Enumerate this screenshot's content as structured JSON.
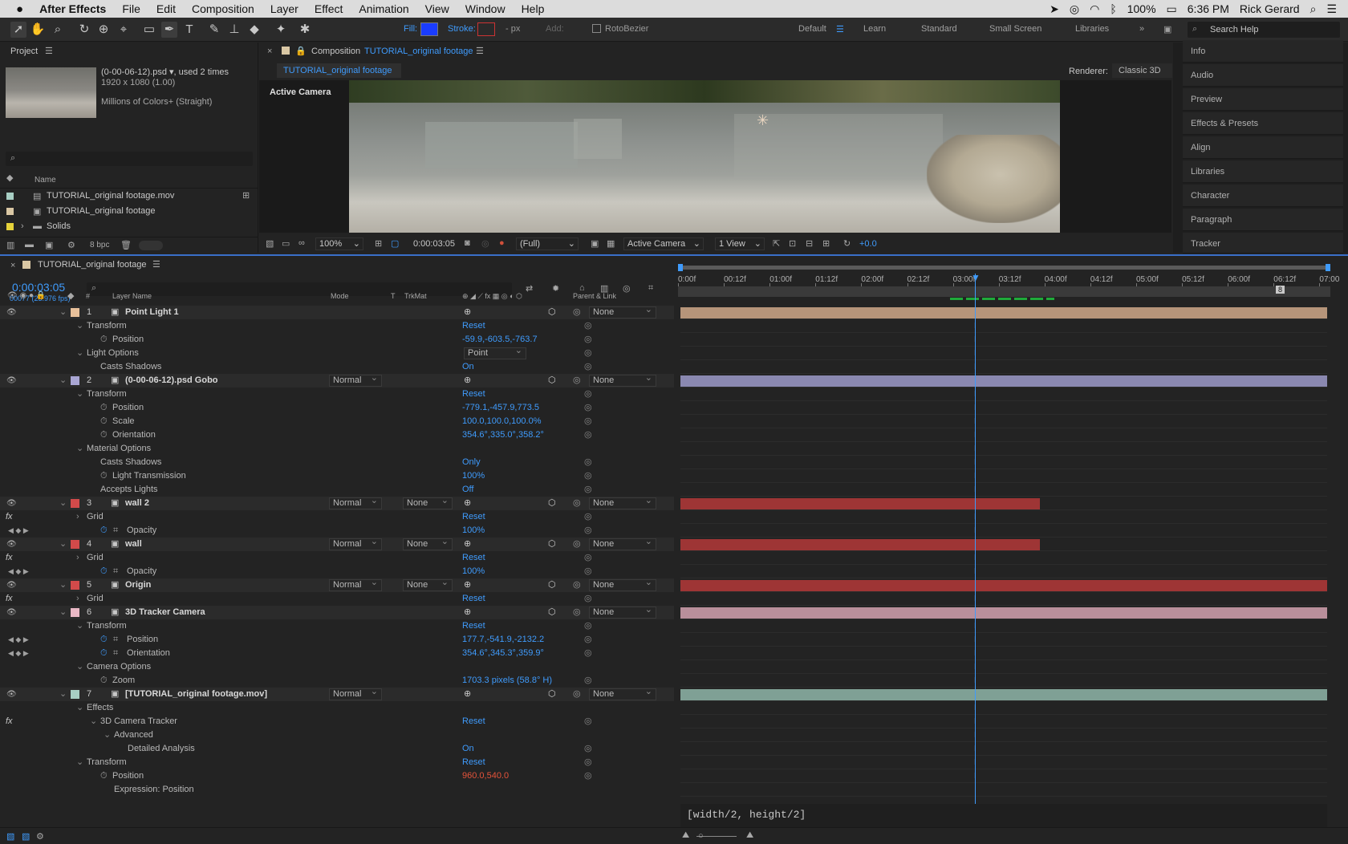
{
  "menubar": {
    "apple": "",
    "app": "After Effects",
    "items": [
      "File",
      "Edit",
      "Composition",
      "Layer",
      "Effect",
      "Animation",
      "View",
      "Window",
      "Help"
    ],
    "battery": "100%",
    "time": "6:36 PM",
    "user": "Rick Gerard"
  },
  "toolbar": {
    "fill_label": "Fill:",
    "stroke_label": "Stroke:",
    "px_label": "- px",
    "add_label": "Add:",
    "rotobezier": "RotoBezier",
    "workspaces": [
      "Default",
      "Learn",
      "Standard",
      "Small Screen",
      "Libraries"
    ],
    "search_placeholder": "Search Help"
  },
  "project": {
    "title": "Project",
    "file_name": "(0-00-06-12).psd",
    "used": ", used 2 times",
    "dims": "1920 x 1080 (1.00)",
    "colors": "Millions of Colors+ (Straight)",
    "search": "",
    "col_name": "Name",
    "items": [
      "TUTORIAL_original footage.mov",
      "TUTORIAL_original footage",
      "Solids"
    ],
    "bpc": "8 bpc"
  },
  "composition": {
    "title_prefix": "Composition",
    "title_name": "TUTORIAL_original footage",
    "tab": "TUTORIAL_original footage",
    "renderer_label": "Renderer:",
    "renderer": "Classic 3D",
    "camera_label": "Active Camera",
    "zoom": "100%",
    "timecode": "0:00:03:05",
    "resolution": "(Full)",
    "view_camera": "Active Camera",
    "views": "1 View",
    "exposure": "+0.0"
  },
  "side": {
    "items": [
      "Info",
      "Audio",
      "Preview",
      "Effects & Presets",
      "Align",
      "Libraries",
      "Character",
      "Paragraph",
      "Tracker"
    ]
  },
  "timeline": {
    "tab": "TUTORIAL_original footage",
    "timecode": "0:00:03:05",
    "frames": "00077 (23.976 fps)",
    "col_num": "#",
    "col_layer": "Layer Name",
    "col_mode": "Mode",
    "col_t": "T",
    "col_trk": "TrkMat",
    "col_parent": "Parent & Link",
    "ruler": [
      "0:00f",
      "00:12f",
      "01:00f",
      "01:12f",
      "02:00f",
      "02:12f",
      "03:00f",
      "03:12f",
      "04:00f",
      "04:12f",
      "05:00f",
      "05:12f",
      "06:00f",
      "06:12f",
      "07:00"
    ],
    "expression": "[width/2, height/2]",
    "marker": "8"
  },
  "rows": [
    {
      "kind": "layer",
      "num": "1",
      "name": "Point Light 1",
      "color": "#e8c09a",
      "icon": "light-icon",
      "mode": "",
      "trk": "",
      "parent": "None"
    },
    {
      "kind": "group",
      "label": "Transform",
      "reset": "Reset"
    },
    {
      "kind": "prop",
      "label": "Position",
      "value": "-59.9,-603.5,-763.7"
    },
    {
      "kind": "group",
      "label": "Light Options",
      "value": "Point"
    },
    {
      "kind": "sub",
      "label": "Casts Shadows",
      "value": "On"
    },
    {
      "kind": "layer",
      "num": "2",
      "name": "(0-00-06-12).psd Gobo",
      "color": "#a9a6d3",
      "icon": "footage-icon",
      "mode": "Normal",
      "trk": "",
      "parent": "None"
    },
    {
      "kind": "group",
      "label": "Transform",
      "reset": "Reset"
    },
    {
      "kind": "prop",
      "label": "Position",
      "value": "-779.1,-457.9,773.5"
    },
    {
      "kind": "prop",
      "label": "Scale",
      "value": "100.0,100.0,100.0%"
    },
    {
      "kind": "prop",
      "label": "Orientation",
      "value": "354.6°,335.0°,358.2°"
    },
    {
      "kind": "group",
      "label": "Material Options"
    },
    {
      "kind": "sub",
      "label": "Casts Shadows",
      "value": "Only"
    },
    {
      "kind": "prop",
      "label": "Light Transmission",
      "value": "100%"
    },
    {
      "kind": "sub",
      "label": "Accepts Lights",
      "value": "Off"
    },
    {
      "kind": "layer",
      "num": "3",
      "name": "wall 2",
      "color": "#d24a4a",
      "icon": "solid-icon",
      "mode": "Normal",
      "trk": "None",
      "parent": "None"
    },
    {
      "kind": "fxgroup",
      "label": "Grid",
      "reset": "Reset"
    },
    {
      "kind": "kprop",
      "label": "Opacity",
      "value": "100%"
    },
    {
      "kind": "layer",
      "num": "4",
      "name": "wall",
      "color": "#d24a4a",
      "icon": "solid-icon",
      "mode": "Normal",
      "trk": "None",
      "parent": "None"
    },
    {
      "kind": "fxgroup",
      "label": "Grid",
      "reset": "Reset"
    },
    {
      "kind": "kprop",
      "label": "Opacity",
      "value": "100%"
    },
    {
      "kind": "layer",
      "num": "5",
      "name": "Origin",
      "color": "#d24a4a",
      "icon": "null-icon",
      "mode": "Normal",
      "trk": "None",
      "parent": "None"
    },
    {
      "kind": "fxgroup",
      "label": "Grid",
      "reset": "Reset"
    },
    {
      "kind": "layer",
      "num": "6",
      "name": "3D Tracker Camera",
      "color": "#e9b8c5",
      "icon": "camera-icon",
      "mode": "",
      "trk": "",
      "parent": "None"
    },
    {
      "kind": "group",
      "label": "Transform",
      "reset": "Reset"
    },
    {
      "kind": "kprop",
      "label": "Position",
      "value": "177.7,-541.9,-2132.2"
    },
    {
      "kind": "kprop",
      "label": "Orientation",
      "value": "354.6°,345.3°,359.9°"
    },
    {
      "kind": "group",
      "label": "Camera Options"
    },
    {
      "kind": "prop",
      "label": "Zoom",
      "value": "1703.3 pixels (58.8° H)"
    },
    {
      "kind": "layer",
      "num": "7",
      "name": "[TUTORIAL_original footage.mov]",
      "color": "#a8cfc4",
      "icon": "footage-icon",
      "mode": "Normal",
      "trk": "",
      "parent": "None"
    },
    {
      "kind": "group",
      "label": "Effects"
    },
    {
      "kind": "fxgroup2",
      "label": "3D Camera Tracker",
      "reset": "Reset"
    },
    {
      "kind": "sub2",
      "label": "Advanced"
    },
    {
      "kind": "sub3",
      "label": "Detailed Analysis",
      "value": "On"
    },
    {
      "kind": "group",
      "label": "Transform",
      "reset": "Reset"
    },
    {
      "kind": "propred",
      "label": "Position",
      "value": "960.0,540.0"
    },
    {
      "kind": "expr",
      "label": "Expression: Position"
    }
  ]
}
